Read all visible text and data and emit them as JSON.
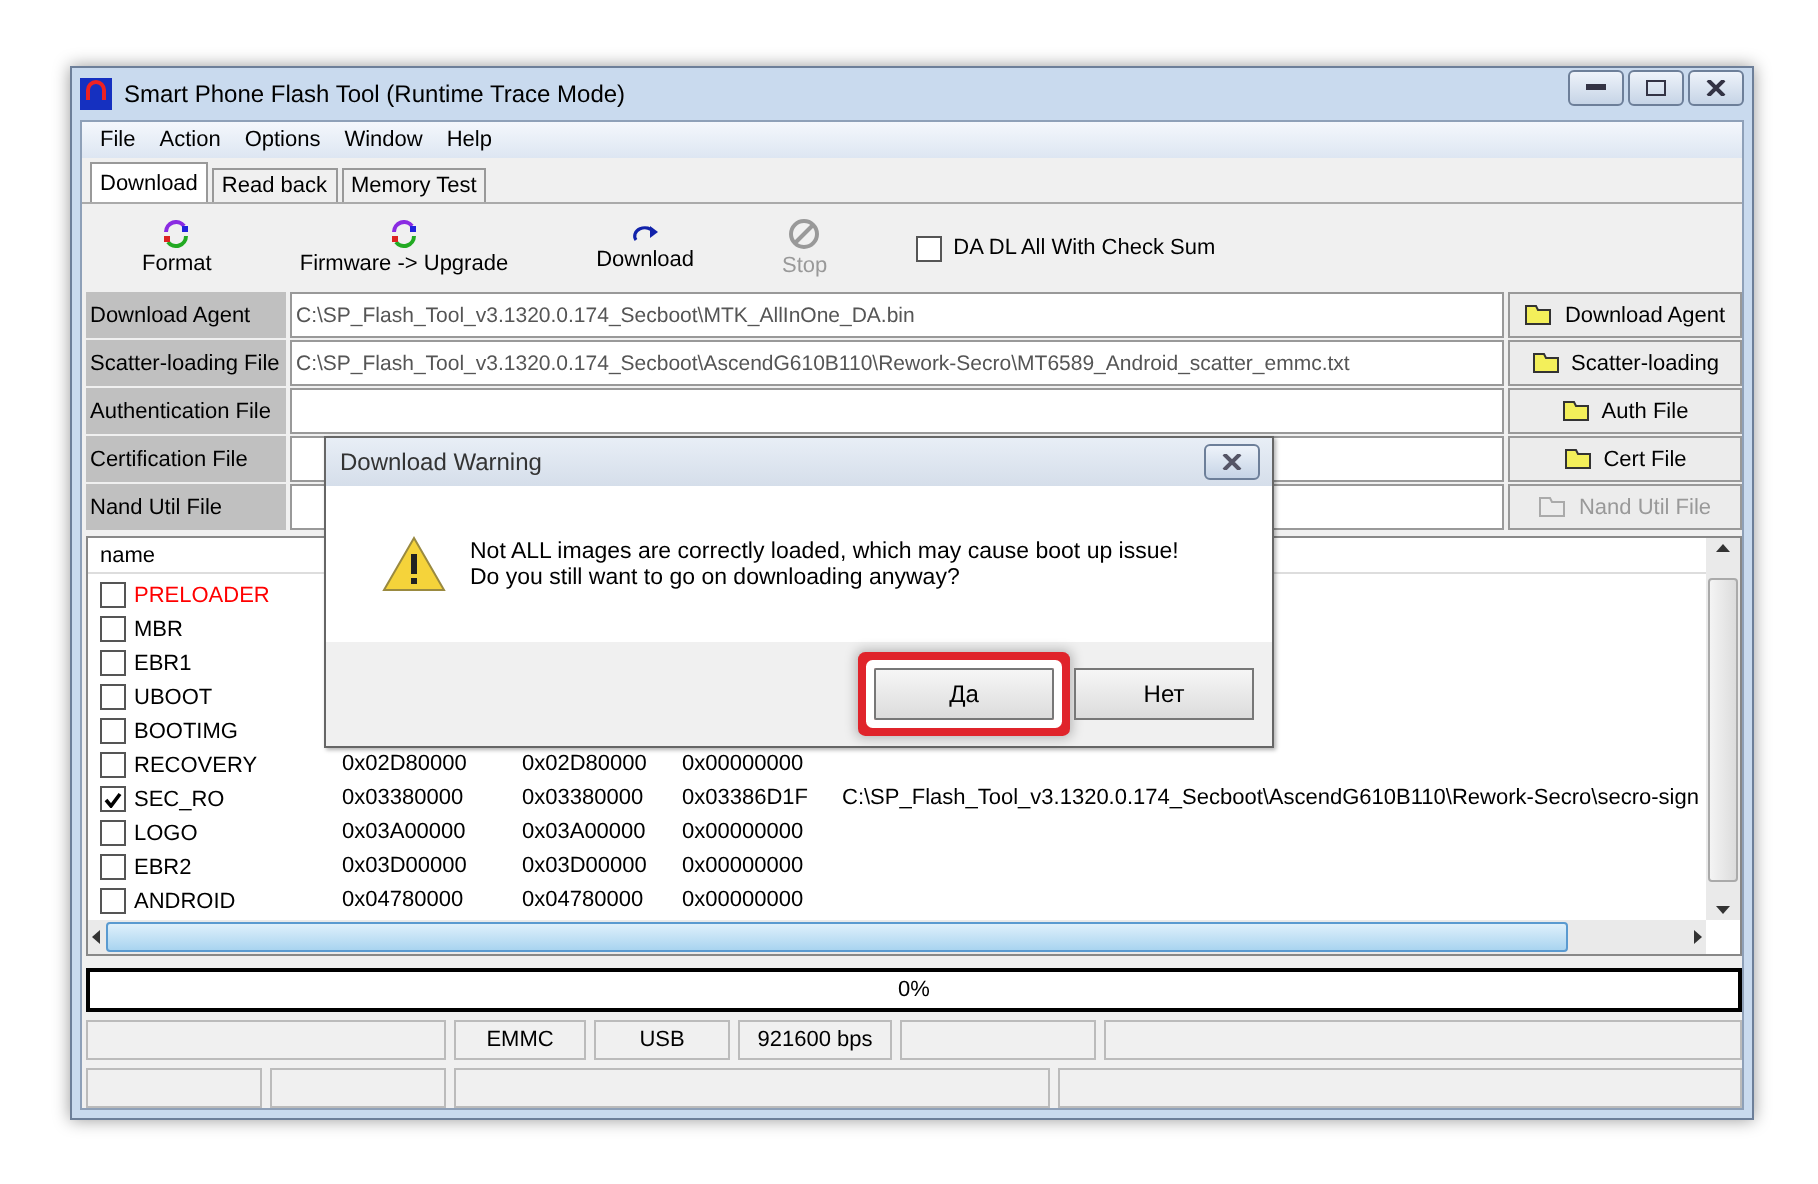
{
  "window": {
    "title": "Smart Phone Flash Tool (Runtime Trace Mode)"
  },
  "menu": [
    "File",
    "Action",
    "Options",
    "Window",
    "Help"
  ],
  "tabs": [
    {
      "label": "Download",
      "selected": true
    },
    {
      "label": "Read back",
      "selected": false
    },
    {
      "label": "Memory Test",
      "selected": false
    }
  ],
  "toolbar": [
    {
      "kind": "format",
      "label": "Format",
      "disabled": false
    },
    {
      "kind": "upgrade",
      "label": "Firmware -> Upgrade",
      "disabled": false
    },
    {
      "kind": "download",
      "label": "Download",
      "disabled": false
    },
    {
      "kind": "stop",
      "label": "Stop",
      "disabled": true
    }
  ],
  "checksum": {
    "label": "DA DL All With Check Sum",
    "checked": false
  },
  "files": [
    {
      "label": "Download Agent",
      "value": "C:\\SP_Flash_Tool_v3.1320.0.174_Secboot\\MTK_AllInOne_DA.bin",
      "button": "Download Agent",
      "disabled": false
    },
    {
      "label": "Scatter-loading File",
      "value": "C:\\SP_Flash_Tool_v3.1320.0.174_Secboot\\AscendG610B110\\Rework-Secro\\MT6589_Android_scatter_emmc.txt",
      "button": "Scatter-loading",
      "disabled": false
    },
    {
      "label": "Authentication File",
      "button": "Auth File",
      "disabled": false
    },
    {
      "label": "Certification File",
      "button": "Cert File",
      "disabled": false
    },
    {
      "label": "Nand Util File",
      "button": "Nand Util File",
      "disabled": true
    }
  ],
  "list": {
    "columns": [
      "name"
    ],
    "rows": [
      {
        "name": "PRELOADER",
        "checked": false,
        "color": "#ff0000"
      },
      {
        "name": "MBR",
        "checked": false,
        "color": "#000000"
      },
      {
        "name": "EBR1",
        "checked": false,
        "color": "#000000"
      },
      {
        "name": "UBOOT",
        "checked": false,
        "color": "#000000"
      },
      {
        "name": "BOOTIMG",
        "checked": false,
        "color": "#000000"
      },
      {
        "name": "RECOVERY",
        "checked": false,
        "color": "#000000",
        "cells": [
          "0x02D80000",
          "0x02D80000",
          "0x00000000"
        ]
      },
      {
        "name": "SEC_RO",
        "checked": true,
        "color": "#000000",
        "cells": [
          "0x03380000",
          "0x03380000",
          "0x03386D1F",
          "C:\\SP_Flash_Tool_v3.1320.0.174_Secboot\\AscendG610B110\\Rework-Secro\\secro-sign"
        ]
      },
      {
        "name": "LOGO",
        "checked": false,
        "color": "#000000",
        "cells": [
          "0x03A00000",
          "0x03A00000",
          "0x00000000"
        ]
      },
      {
        "name": "EBR2",
        "checked": false,
        "color": "#000000",
        "cells": [
          "0x03D00000",
          "0x03D00000",
          "0x00000000"
        ]
      },
      {
        "name": "ANDROID",
        "checked": false,
        "color": "#000000",
        "cells": [
          "0x04780000",
          "0x04780000",
          "0x00000000"
        ]
      }
    ]
  },
  "progress": {
    "label": "0%",
    "level": 0
  },
  "status_bar": [
    "EMMC",
    "USB",
    "921600 bps"
  ],
  "dialog": {
    "title": "Download Warning",
    "lines": [
      "Not ALL images are correctly loaded, which may cause boot up issue!",
      "Do you still want to go on downloading anyway?"
    ],
    "buttons": [
      {
        "label": "Да",
        "highlighted": true
      },
      {
        "label": "Нет",
        "highlighted": false
      }
    ]
  }
}
